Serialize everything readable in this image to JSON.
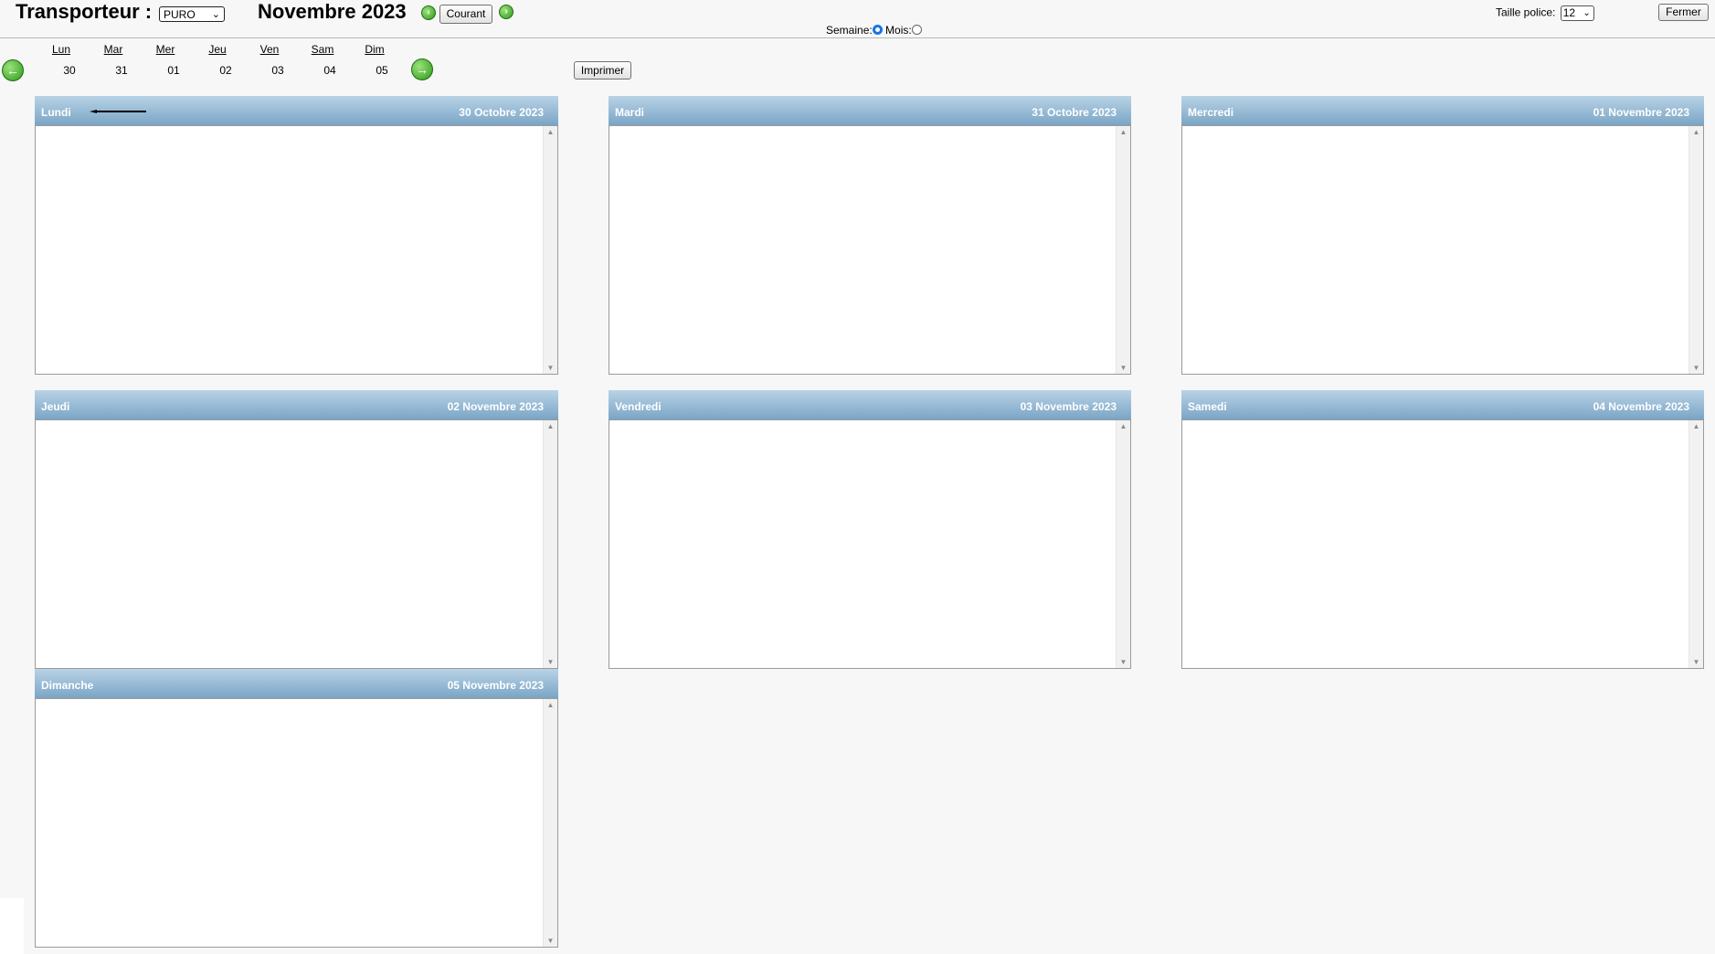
{
  "header": {
    "title_label": "Transporteur :",
    "carrier_value": "PURO",
    "month_title": "Novembre 2023",
    "current_button": "Courant",
    "week_radio_label": "Semaine:",
    "month_radio_label": "Mois:",
    "font_size_label": "Taille police:",
    "font_size_value": "12",
    "close_button": "Fermer"
  },
  "week_nav": {
    "days": [
      {
        "name": "Lun",
        "num": "30"
      },
      {
        "name": "Mar",
        "num": "31"
      },
      {
        "name": "Mer",
        "num": "01"
      },
      {
        "name": "Jeu",
        "num": "02"
      },
      {
        "name": "Ven",
        "num": "03"
      },
      {
        "name": "Sam",
        "num": "04"
      },
      {
        "name": "Dim",
        "num": "05"
      }
    ],
    "print_button": "Imprimer"
  },
  "panels": [
    {
      "day": "Lundi",
      "date": "30 Octobre 2023"
    },
    {
      "day": "Mardi",
      "date": "31 Octobre 2023"
    },
    {
      "day": "Mercredi",
      "date": "01 Novembre 2023"
    },
    {
      "day": "Jeudi",
      "date": "02 Novembre 2023"
    },
    {
      "day": "Vendredi",
      "date": "03 Novembre 2023"
    },
    {
      "day": "Samedi",
      "date": "04 Novembre 2023"
    },
    {
      "day": "Dimanche",
      "date": "05 Novembre 2023"
    }
  ]
}
